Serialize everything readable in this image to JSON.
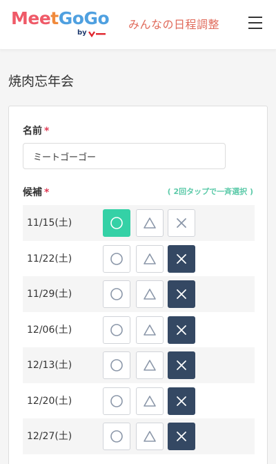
{
  "header": {
    "logo": {
      "part1": "Mee",
      "part2": "t",
      "part3": "GoGo",
      "by": "by"
    },
    "tagline": "みんなの日程調整"
  },
  "event": {
    "title": "焼肉忘年会"
  },
  "form": {
    "name_label": "名前",
    "required_mark": "*",
    "name_value": "ミートゴーゴー",
    "candidates_label": "候補",
    "hint": "( 2回タップで一斉選択 )"
  },
  "candidates": [
    {
      "date": "11/15(土)",
      "selected": "o"
    },
    {
      "date": "11/22(土)",
      "selected": "x"
    },
    {
      "date": "11/29(土)",
      "selected": "x"
    },
    {
      "date": "12/06(土)",
      "selected": "x"
    },
    {
      "date": "12/13(土)",
      "selected": "x"
    },
    {
      "date": "12/20(土)",
      "selected": "x"
    },
    {
      "date": "12/27(土)",
      "selected": "x"
    }
  ],
  "colors": {
    "selected_circle": "#34d1a6",
    "selected_cross": "#344863",
    "accent_hint": "#5ccaa9",
    "required": "#e03b55"
  },
  "icons": {
    "menu": "hamburger-icon",
    "yes": "circle-icon",
    "maybe": "triangle-icon",
    "no": "cross-icon"
  }
}
